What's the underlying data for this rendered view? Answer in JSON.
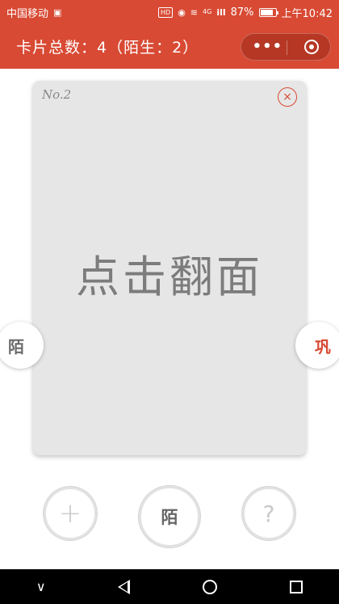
{
  "status_bar": {
    "carrier": "中国移动",
    "hd": "HD",
    "network": "4G",
    "signal": "ill",
    "battery_percent": "87%",
    "battery_level": 0.87,
    "time": "上午10:42"
  },
  "nav_bar": {
    "title": "卡片总数：4（陌生：2）",
    "more": "•••"
  },
  "card": {
    "number": "No.2",
    "close": "×",
    "text": "点击翻面"
  },
  "side_buttons": {
    "left": "陌",
    "right": "巩"
  },
  "bottom_buttons": {
    "add": "+",
    "strange": "陌",
    "help": "?"
  },
  "android_nav": {
    "down": "∨"
  },
  "colors": {
    "accent": "#d84a34",
    "card_bg": "#e6e6e6"
  }
}
